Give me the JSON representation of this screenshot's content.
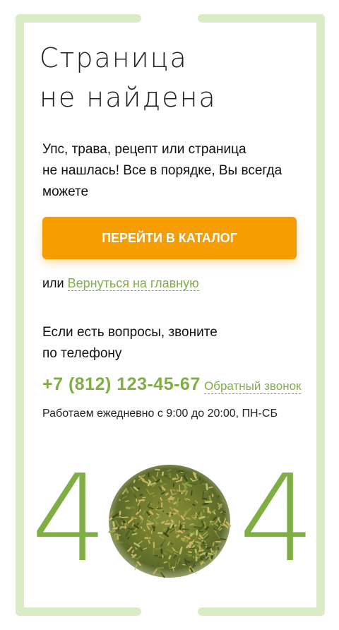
{
  "title": {
    "line1": "Страница",
    "line2": "не найдена"
  },
  "message": {
    "line1": "Упс, трава, рецепт или страница",
    "line2": "не нашлась! Все в порядке, Вы всегда",
    "line3": "можете"
  },
  "catalog_button": "ПЕРЕЙТИ В КАТАЛОГ",
  "or_text": "или",
  "home_link": "Вернуться на главную",
  "questions": {
    "line1": "Если есть вопросы, звоните",
    "line2": "по телефону"
  },
  "phone": "+7 (812) 123-45-67",
  "callback_link": "Обратный звонок",
  "hours": "Работаем ежедневно с 9:00 до 20:00, ПН-СБ",
  "error": {
    "digit_left": "4",
    "digit_right": "4"
  },
  "colors": {
    "accent_green": "#7fae45",
    "button_orange": "#f59c00",
    "frame_green": "#d9ecc6"
  }
}
